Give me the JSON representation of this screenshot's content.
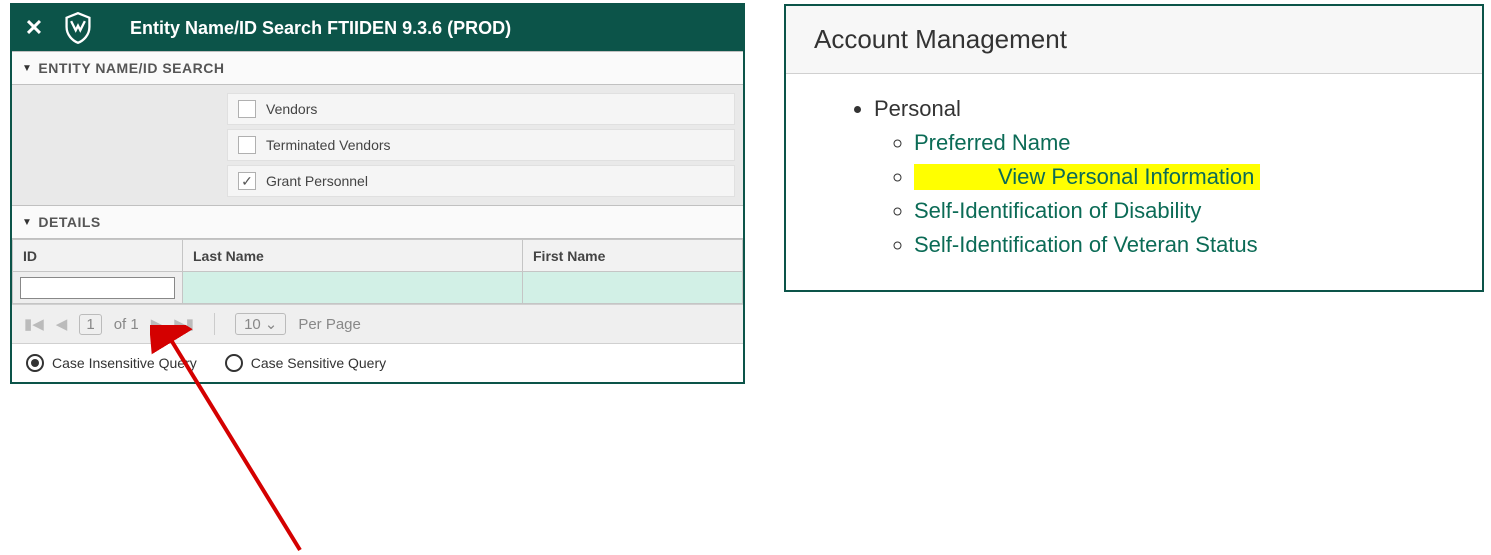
{
  "left": {
    "title": "Entity Name/ID Search FTIIDEN 9.3.6 (PROD)",
    "section1": "ENTITY NAME/ID SEARCH",
    "checkboxes": [
      {
        "label": "Vendors",
        "checked": false
      },
      {
        "label": "Terminated Vendors",
        "checked": false
      },
      {
        "label": "Grant Personnel",
        "checked": true
      }
    ],
    "section2": "DETAILS",
    "cols": {
      "id": "ID",
      "last": "Last Name",
      "first": "First Name"
    },
    "pager": {
      "page": "1",
      "of": "of 1",
      "size": "10",
      "perpage": "Per Page"
    },
    "query": {
      "insensitive": "Case Insensitive Query",
      "sensitive": "Case Sensitive Query"
    }
  },
  "right": {
    "title": "Account Management",
    "root": "Personal",
    "items": [
      "Preferred Name",
      "View Personal Information",
      "Self-Identification of Disability",
      "Self-Identification of Veteran Status"
    ]
  }
}
